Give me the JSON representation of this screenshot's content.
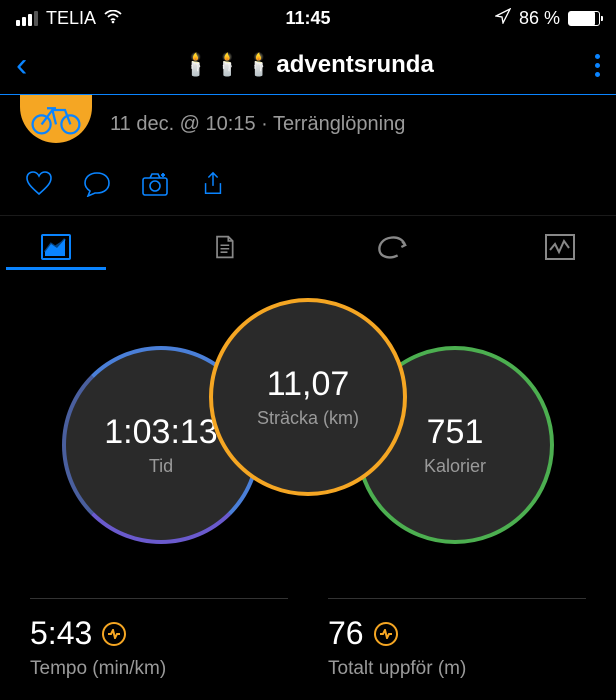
{
  "status": {
    "carrier": "TELIA",
    "time": "11:45",
    "battery_pct": "86 %"
  },
  "nav": {
    "title": "adventsrunda"
  },
  "activity": {
    "meta": "11 dec. @ 10:15 · Terränglöpning"
  },
  "circles": {
    "distance": {
      "value": "11,07",
      "label": "Sträcka (km)"
    },
    "time": {
      "value": "1:03:13",
      "label": "Tid"
    },
    "calories": {
      "value": "751",
      "label": "Kalorier"
    }
  },
  "stats": {
    "pace": {
      "value": "5:43",
      "label": "Tempo (min/km)"
    },
    "ascent": {
      "value": "76",
      "label": "Totalt uppför (m)"
    }
  }
}
